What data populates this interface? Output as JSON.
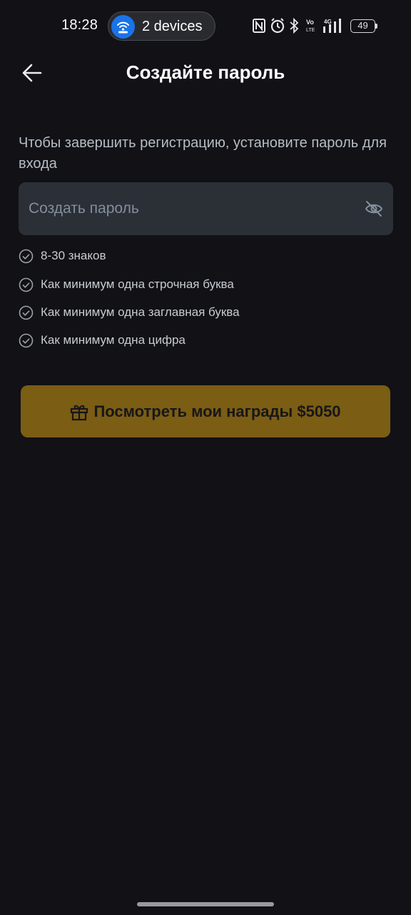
{
  "status_bar": {
    "time": "18:28",
    "hotspot_label": "2 devices",
    "battery_level": "49",
    "icons": [
      "nfc-icon",
      "alarm-icon",
      "bluetooth-icon",
      "volte-icon",
      "4g-signal-icon",
      "battery-icon"
    ]
  },
  "header": {
    "title": "Создайте пароль",
    "back_icon": "arrow-left-icon"
  },
  "form": {
    "instructions": "Чтобы завершить регистрацию, установите пароль для входа",
    "password_placeholder": "Создать пароль",
    "password_value": "",
    "visibility_icon": "eye-off-icon"
  },
  "rules": [
    {
      "label": "8-30 знаков",
      "met": false
    },
    {
      "label": "Как минимум одна строчная буква",
      "met": false
    },
    {
      "label": "Как минимум одна заглавная буква",
      "met": false
    },
    {
      "label": "Как минимум одна цифра",
      "met": false
    }
  ],
  "rewards_button": {
    "label": "Посмотреть мои награды $5050",
    "icon": "gift-icon"
  },
  "colors": {
    "background": "#111116",
    "field_background": "#2b2f36",
    "accent_button": "#7b5d13",
    "text_primary": "#ffffff",
    "text_secondary": "#b7bdc6"
  }
}
